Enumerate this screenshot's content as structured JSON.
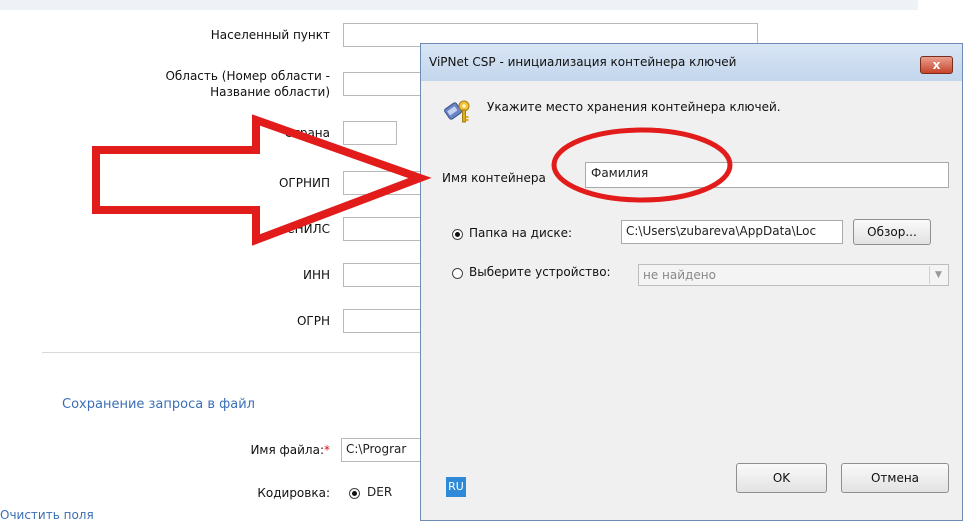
{
  "form": {
    "labels": {
      "locality": "Населенный пункт",
      "region_line1": "Область (Номер области -",
      "region_line2": "Название области)",
      "country": "Страна",
      "ogrnip": "ОГРНИП",
      "snils": "СНИЛС",
      "inn": "ИНН",
      "ogrn": "ОГРН"
    },
    "section_title": "Сохранение запроса в файл",
    "filename_label": "Имя файла:",
    "required_mark": "*",
    "filename_value": "C:\\Prograr",
    "encoding_label": "Кодировка:",
    "encoding_option": "DER",
    "clear_link": "Очистить поля"
  },
  "dialog": {
    "title": "ViPNet CSP - инициализация контейнера ключей",
    "close_label": "x",
    "instruction": "Укажите место хранения контейнера ключей.",
    "container_label": "Имя контейнера",
    "container_value": "Фамилия",
    "folder_label": "Папка на диске:",
    "folder_value": "C:\\Users\\zubareva\\AppData\\Loc",
    "browse_label": "Обзор...",
    "device_label": "Выберите устройство:",
    "device_value": "не найдено",
    "lang_indicator": "RU",
    "ok_label": "OK",
    "cancel_label": "Отмена"
  },
  "colors": {
    "annotation_red": "#e21b1b",
    "link_blue": "#3b6fb6"
  }
}
